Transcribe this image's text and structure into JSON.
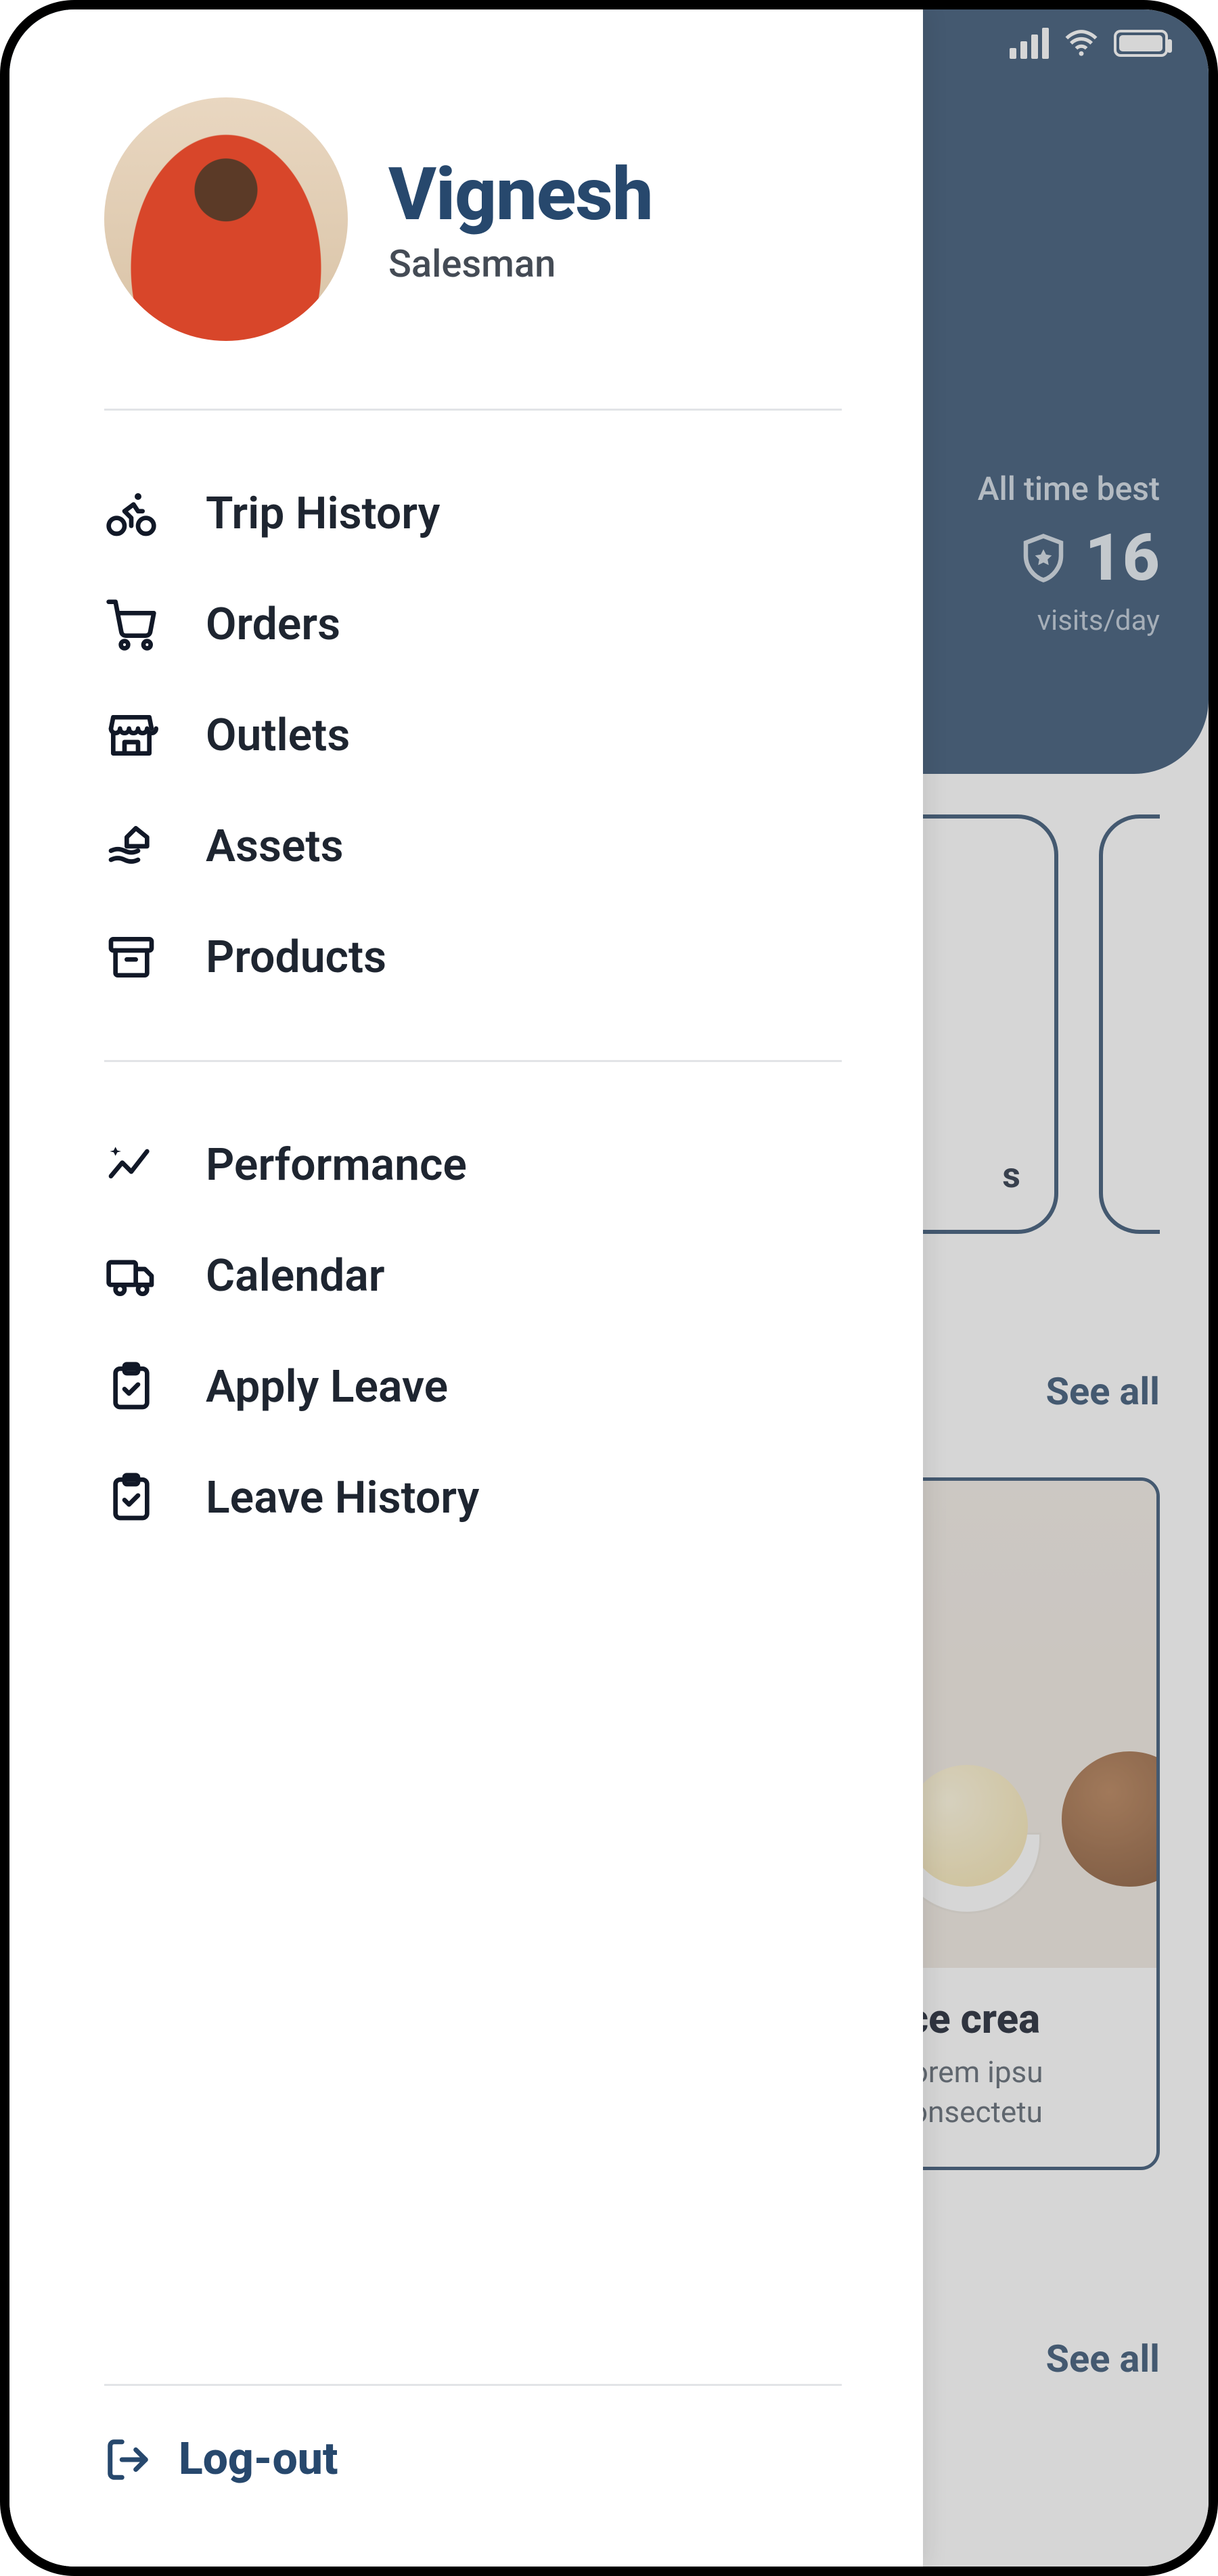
{
  "profile": {
    "name": "Vignesh",
    "role": "Salesman"
  },
  "drawer": {
    "group1": [
      {
        "icon": "bicycle-icon",
        "label": "Trip History"
      },
      {
        "icon": "cart-icon",
        "label": "Orders"
      },
      {
        "icon": "storefront-icon",
        "label": "Outlets"
      },
      {
        "icon": "assets-icon",
        "label": "Assets"
      },
      {
        "icon": "archive-icon",
        "label": "Products"
      }
    ],
    "group2": [
      {
        "icon": "trend-icon",
        "label": "Performance"
      },
      {
        "icon": "van-icon",
        "label": "Calendar"
      },
      {
        "icon": "clipboard-icon",
        "label": "Apply Leave"
      },
      {
        "icon": "clipboard-icon",
        "label": "Leave History"
      }
    ],
    "logout_label": "Log-out"
  },
  "screen": {
    "stat": {
      "label": "All time best",
      "value": "16",
      "unit": "visits/day"
    },
    "quick_card_suffix": "s",
    "see_all": "See all",
    "product": {
      "title": "Ice crea",
      "desc1": "Lorem ipsu",
      "desc2": "consectetu"
    }
  }
}
